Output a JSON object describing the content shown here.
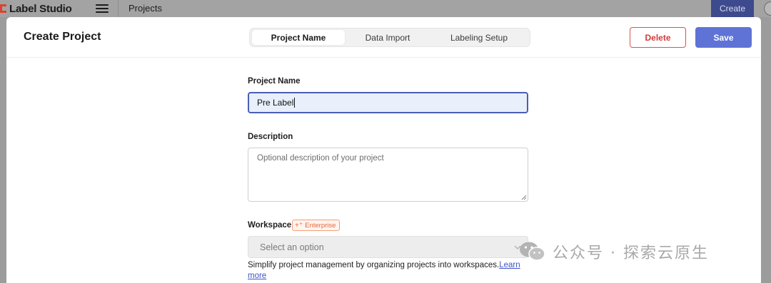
{
  "topbar": {
    "brand": "Label Studio",
    "breadcrumb": "Projects",
    "create_label": "Create"
  },
  "modal": {
    "title": "Create Project",
    "steps": [
      {
        "label": "Project Name",
        "active": true
      },
      {
        "label": "Data Import",
        "active": false
      },
      {
        "label": "Labeling Setup",
        "active": false
      }
    ],
    "delete_label": "Delete",
    "save_label": "Save"
  },
  "form": {
    "project_name_label": "Project Name",
    "project_name_value": "Pre Label",
    "description_label": "Description",
    "description_placeholder": "Optional description of your project",
    "workspace_label": "Workspace",
    "enterprise_badge": "Enterprise",
    "workspace_placeholder": "Select an option",
    "help_text": "Simplify project management by organizing projects into workspaces.",
    "help_link": "Learn more"
  },
  "watermark": {
    "text": "公众号 · 探索云原生"
  },
  "colors": {
    "accent": "#5f73d6",
    "danger": "#d23a3a",
    "enterprise": "#e5683c"
  }
}
